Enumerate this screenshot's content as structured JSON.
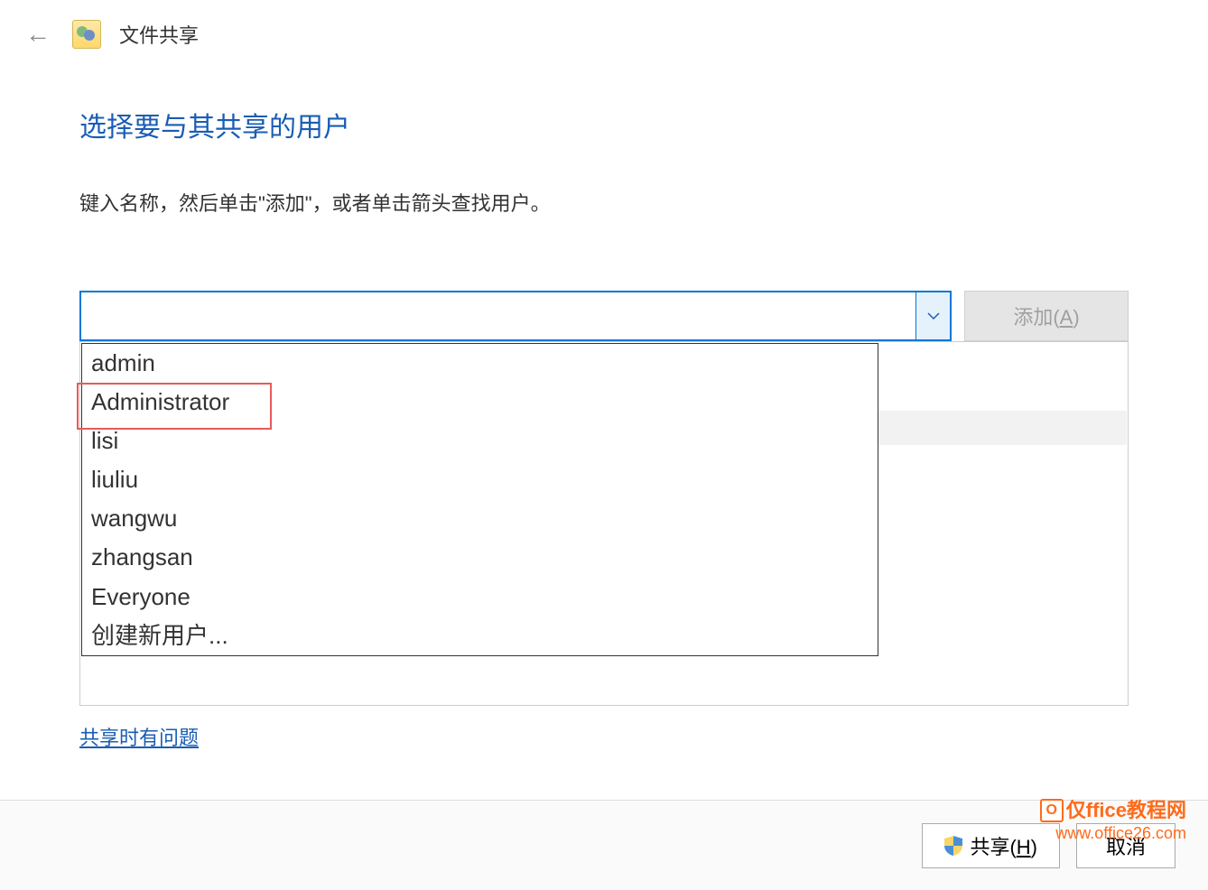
{
  "window": {
    "title": "文件共享"
  },
  "main": {
    "heading": "选择要与其共享的用户",
    "instruction": "键入名称，然后单击\"添加\"，或者单击箭头查找用户。"
  },
  "inputRow": {
    "comboValue": "",
    "addButton": "添加(",
    "addButtonKey": "A",
    "addButtonClose": ")"
  },
  "dropdown": {
    "items": [
      "admin",
      "Administrator",
      "lisi",
      "liuliu",
      "wangwu",
      "zhangsan",
      "Everyone",
      "创建新用户..."
    ]
  },
  "helpLink": "共享时有问题",
  "buttons": {
    "sharePrefix": "共享(",
    "shareKey": "H",
    "shareSuffix": ")",
    "cancel": "取消"
  },
  "watermark": {
    "line1": "仅ffice教程网",
    "line2": "www.office26.com"
  }
}
